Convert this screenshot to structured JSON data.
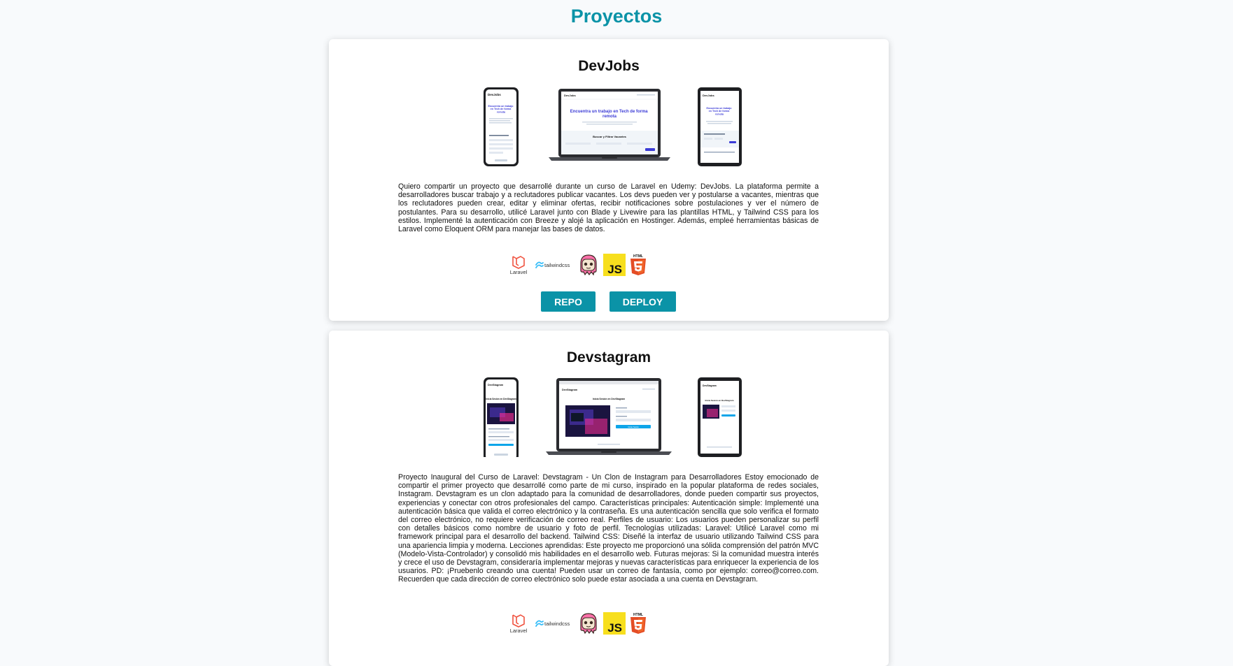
{
  "page": {
    "title": "Proyectos"
  },
  "projects": [
    {
      "title": "DevJobs",
      "description": "Quiero compartir un proyecto que desarrollé durante un curso de Laravel en Udemy: DevJobs. La plataforma permite a desarrolladores buscar trabajo y a reclutadores publicar vacantes. Los devs pueden ver y postularse a vacantes, mientras que los reclutadores pueden crear, editar y eliminar ofertas, recibir notificaciones sobre postulaciones y ver el número de postulantes. Para su desarrollo, utilicé Laravel junto con Blade y Livewire para las plantillas HTML, y Tailwind CSS para los estilos. Implementé la autenticación con Breeze y alojé la aplicación en Hostinger. Además, empleé herramientas básicas de Laravel como Eloquent ORM para manejar las bases de datos.",
      "screens": {
        "logo": "DevJobs",
        "laptop_heading": "Encuentra un trabajo en Tech de forma remota",
        "laptop_section": "Buscar y Filtrar Vacantes",
        "phone_heading": "Encuentra un trabajo en Tech de forma remota",
        "tablet_heading": "Encuentra un trabajo en Tech de forma remota"
      },
      "tech": [
        "Laravel",
        "tailwindcss",
        "livewire-icon",
        "JS",
        "HTML"
      ],
      "buttons": {
        "repo": "REPO",
        "deploy": "DEPLOY"
      }
    },
    {
      "title": "Devstagram",
      "description": "Proyecto Inaugural del Curso de Laravel: Devstagram - Un Clon de Instagram para Desarrolladores Estoy emocionado de compartir el primer proyecto que desarrollé como parte de mi curso, inspirado en la popular plataforma de redes sociales, Instagram. Devstagram es un clon adaptado para la comunidad de desarrolladores, donde pueden compartir sus proyectos, experiencias y conectar con otros profesionales del campo. Características principales: Autenticación simple: Implementé una autenticación básica que valida el correo electrónico y la contraseña. Es una autenticación sencilla que solo verifica el formato del correo electrónico, no requiere verificación de correo real. Perfiles de usuario: Los usuarios pueden personalizar su perfil con detalles básicos como nombre de usuario y foto de perfil. Tecnologías utilizadas: Laravel: Utilicé Laravel como mi framework principal para el desarrollo del backend. Tailwind CSS: Diseñé la interfaz de usuario utilizando Tailwind CSS para una apariencia limpia y moderna. Lecciones aprendidas: Este proyecto me proporcionó una sólida comprensión del patrón MVC (Modelo-Vista-Controlador) y consolidó mis habilidades en el desarrollo web. Futuras mejoras: Si la comunidad muestra interés y crece el uso de Devstagram, consideraría implementar mejoras y nuevas características para enriquecer la experiencia de los usuarios. PD: ¡Pruebenlo creando una cuenta! Pueden usar un correo de fantasía, como por ejemplo: correo@correo.com. Recuerden que cada dirección de correo electrónico solo puede estar asociada a una cuenta en Devstagram.",
      "screens": {
        "logo": "DevStagram",
        "laptop_heading": "Inicia Sesión en DevStagram",
        "phone_heading": "Inicia Sesión en DevStagram",
        "tablet_heading": "Inicia Sesión en DevStagram",
        "button": "Iniciar Sesión"
      },
      "tech": [
        "Laravel",
        "tailwindcss",
        "livewire-icon",
        "JS",
        "HTML"
      ]
    }
  ],
  "colors": {
    "accent": "#0b93a7",
    "devjobs_heading": "#3b3bd6",
    "laravel": "#f05340",
    "tailwind": "#38bdf8",
    "js_bg": "#f7df1e",
    "html5": "#e44d26"
  }
}
